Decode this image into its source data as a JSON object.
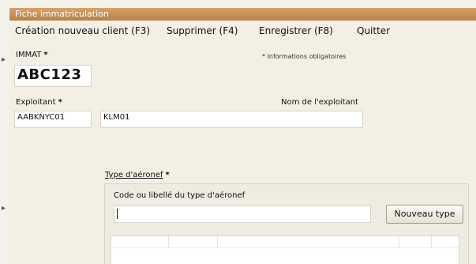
{
  "window": {
    "title": "Fiche immatriculation"
  },
  "menu": [
    {
      "label": "Création nouveau client (F3)"
    },
    {
      "label": "Supprimer (F4)"
    },
    {
      "label": "Enregistrer (F8)"
    },
    {
      "label": "Quitter"
    }
  ],
  "form": {
    "immat_label": "IMMAT",
    "required_marker": "*",
    "required_note": "* Informations obligatoires",
    "immat_value": "ABC123",
    "exploitant_label": "Exploitant",
    "exploitant_code": "AABKNYC01",
    "exploitant_short": "KLM01",
    "nom_exploitant_label": "Nom de l'exploitant",
    "nom_exploitant_value": ""
  },
  "aircraft_type": {
    "label": "Type d'aéronef",
    "search_label": "Code ou libellé du type d'aéronef",
    "search_value": "",
    "new_type_button": "Nouveau type"
  }
}
